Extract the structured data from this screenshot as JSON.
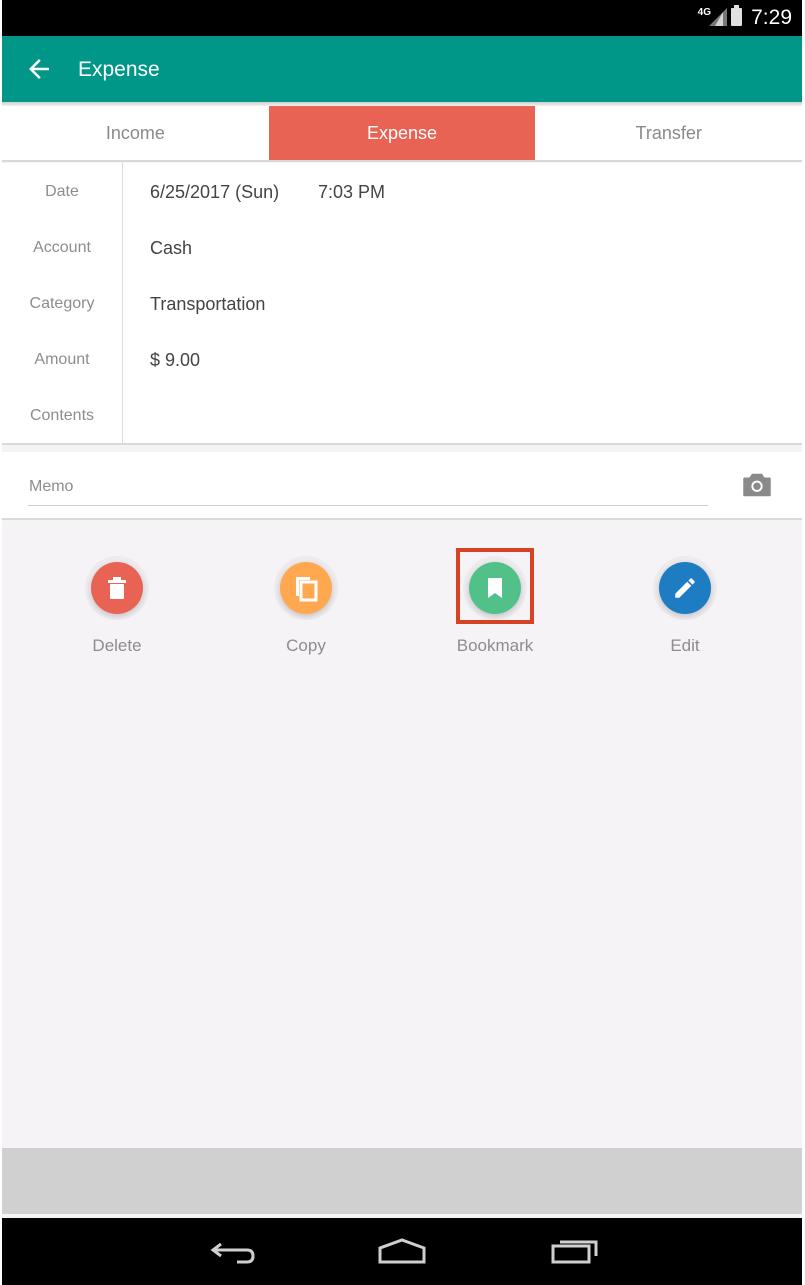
{
  "status_bar": {
    "network": "4G",
    "time": "7:29"
  },
  "app_bar": {
    "title": "Expense"
  },
  "tabs": [
    {
      "label": "Income",
      "active": false
    },
    {
      "label": "Expense",
      "active": true
    },
    {
      "label": "Transfer",
      "active": false
    }
  ],
  "form": {
    "date": {
      "label": "Date",
      "value": "6/25/2017 (Sun)",
      "time": "7:03 PM"
    },
    "account": {
      "label": "Account",
      "value": "Cash"
    },
    "category": {
      "label": "Category",
      "value": "Transportation"
    },
    "amount": {
      "label": "Amount",
      "value": "$ 9.00"
    },
    "contents": {
      "label": "Contents",
      "value": ""
    }
  },
  "memo": {
    "label": "Memo"
  },
  "actions": [
    {
      "label": "Delete",
      "icon": "trash-icon",
      "color": "#e96355"
    },
    {
      "label": "Copy",
      "icon": "copy-icon",
      "color": "#ffa84f"
    },
    {
      "label": "Bookmark",
      "icon": "bookmark-icon",
      "color": "#52c189"
    },
    {
      "label": "Edit",
      "icon": "pencil-icon",
      "color": "#1e7cc2"
    }
  ],
  "colors": {
    "primary": "#009688",
    "expense_tab": "#e96355",
    "highlight": "#d64324"
  }
}
